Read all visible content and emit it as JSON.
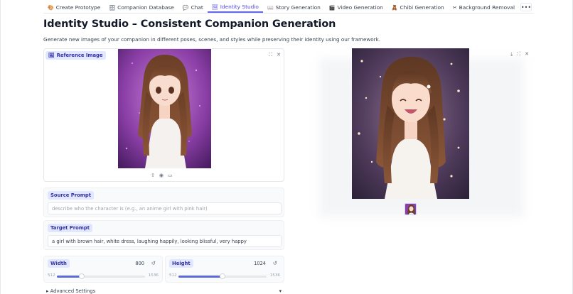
{
  "tabs": [
    {
      "icon": "palette-icon",
      "glyph": "🎨",
      "label": "Create Prototype",
      "active": false
    },
    {
      "icon": "database-icon",
      "glyph": "🗄",
      "label": "Companion Database",
      "active": false
    },
    {
      "icon": "chat-icon",
      "glyph": "💬",
      "label": "Chat",
      "active": false
    },
    {
      "icon": "image-icon",
      "glyph": "🖼",
      "label": "Identity Studio",
      "active": true
    },
    {
      "icon": "book-icon",
      "glyph": "📖",
      "label": "Story Generation",
      "active": false
    },
    {
      "icon": "clapper-icon",
      "glyph": "🎬",
      "label": "Video Generation",
      "active": false
    },
    {
      "icon": "chibi-icon",
      "glyph": "🧸",
      "label": "Chibi Generation",
      "active": false
    },
    {
      "icon": "scissors-icon",
      "glyph": "✂",
      "label": "Background Removal",
      "active": false
    }
  ],
  "more_label": "•••",
  "title": "Identity Studio – Consistent Companion Generation",
  "subtitle": "Generate new images of your companion in different poses, scenes, and styles while preserving their identity using our framework.",
  "reference": {
    "label": "Reference Image"
  },
  "source_prompt": {
    "label": "Source Prompt",
    "placeholder": "describe who the character is (e.g., an anime girl with pink hair)",
    "value": ""
  },
  "target_prompt": {
    "label": "Target Prompt",
    "value": "a girl with brown hair, white dress, laughing happily, looking blissful, very happy"
  },
  "width": {
    "label": "Width",
    "value": "800",
    "min": "512",
    "max": "1536",
    "fraction": 0.281
  },
  "height": {
    "label": "Height",
    "value": "1024",
    "min": "512",
    "max": "1536",
    "fraction": 0.5
  },
  "advanced": {
    "label": "Advanced Settings"
  },
  "colors": {
    "accent": "#6366f1",
    "chip_bg": "#e0e7ff",
    "slider_fill": "#5b6ad6"
  }
}
